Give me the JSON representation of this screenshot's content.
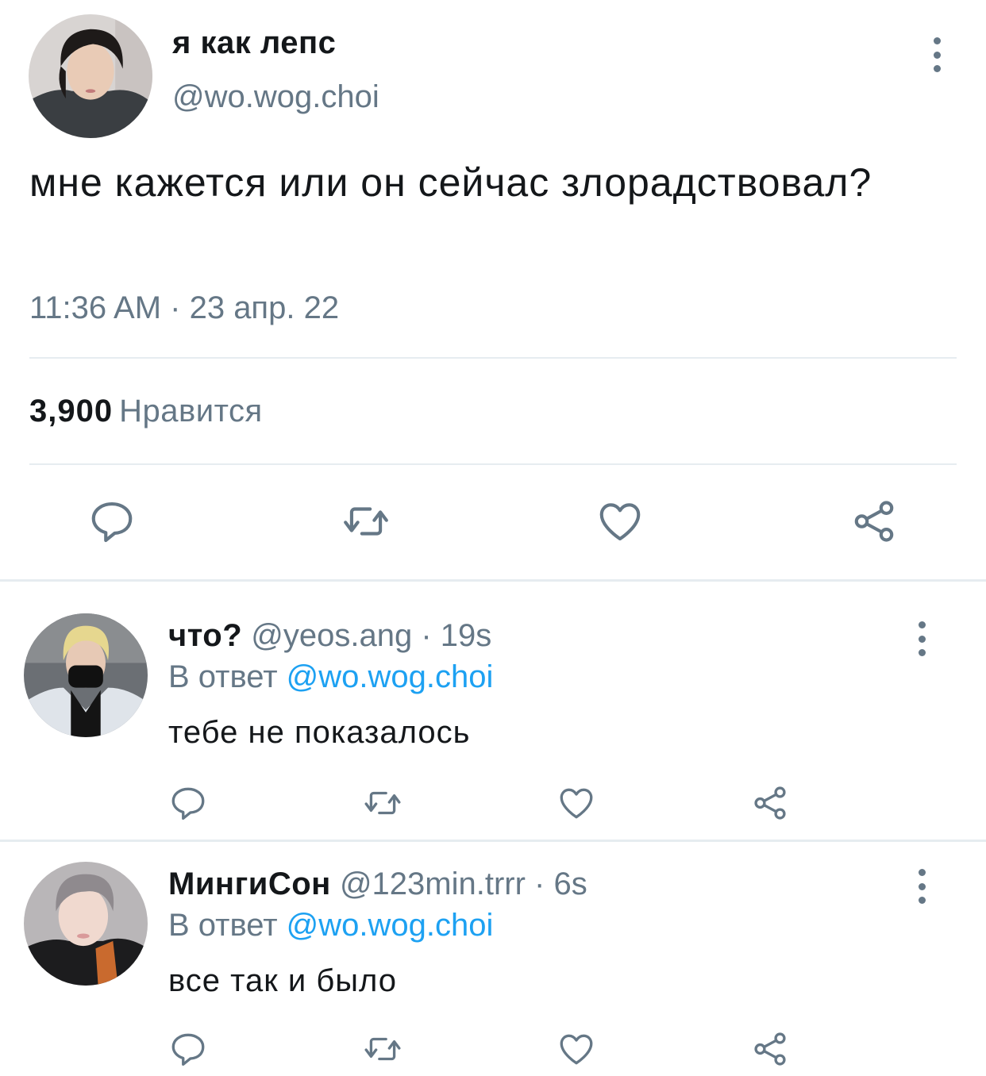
{
  "main_tweet": {
    "display_name": "я как лепс",
    "handle": "@wo.wog.choi",
    "text": "мне кажется или он сейчас злорадствовал?",
    "timestamp": "11:36 AM · 23 апр. 22",
    "likes_count": "3,900",
    "likes_label": "Нравится",
    "avatar_icon": "avatar-photo",
    "more_icon": "more-vertical-icon",
    "actions": [
      "reply-icon",
      "retweet-icon",
      "like-icon",
      "share-icon"
    ]
  },
  "replies": [
    {
      "display_name": "что?",
      "handle_time": "@yeos.ang · 19s",
      "reply_to_label": "В ответ",
      "reply_to_handle": "@wo.wog.choi",
      "text": "тебе не показалось"
    },
    {
      "display_name": "МингиСон",
      "handle_time": "@123min.trrr · 6s",
      "reply_to_label": "В ответ",
      "reply_to_handle": "@wo.wog.choi",
      "text": "все так и было"
    }
  ],
  "colors": {
    "text": "#14171a",
    "secondary": "#657786",
    "link": "#1da1f2",
    "divider": "#e6ecf0"
  }
}
